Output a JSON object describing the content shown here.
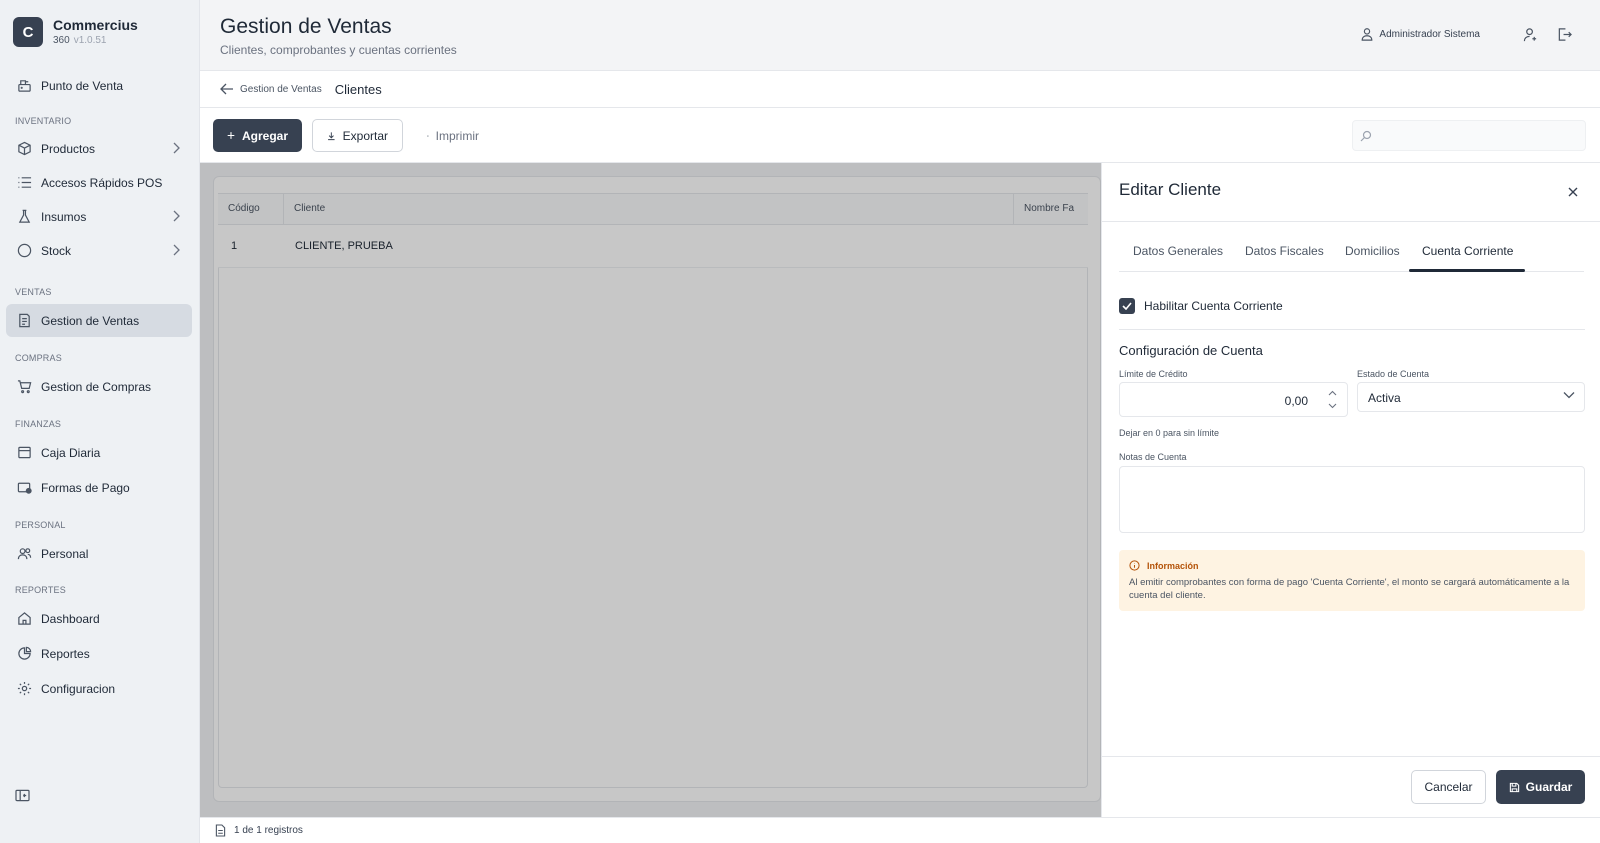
{
  "brand": {
    "logo_letter": "C",
    "name": "Commercius",
    "sub": "360",
    "version": "v1.0.51"
  },
  "sidebar": {
    "items": [
      {
        "label": "Punto de Venta",
        "icon": "cart-register-icon"
      },
      {
        "section": "INVENTARIO"
      },
      {
        "label": "Productos",
        "icon": "box-icon",
        "chevron": true
      },
      {
        "label": "Accesos Rápidos POS",
        "icon": "list-icon"
      },
      {
        "label": "Insumos",
        "icon": "flask-icon",
        "chevron": true
      },
      {
        "label": "Stock",
        "icon": "circle-icon",
        "chevron": true
      },
      {
        "section": "VENTAS"
      },
      {
        "label": "Gestion de Ventas",
        "icon": "receipt-icon",
        "active": true
      },
      {
        "section": "COMPRAS"
      },
      {
        "label": "Gestion de Compras",
        "icon": "shopping-cart-icon"
      },
      {
        "section": "FINANZAS"
      },
      {
        "label": "Caja Diaria",
        "icon": "cash-box-icon"
      },
      {
        "label": "Formas de Pago",
        "icon": "wallet-icon"
      },
      {
        "section": "PERSONAL"
      },
      {
        "label": "Personal",
        "icon": "users-icon"
      },
      {
        "section": "REPORTES"
      },
      {
        "label": "Dashboard",
        "icon": "home-icon"
      },
      {
        "label": "Reportes",
        "icon": "chart-icon"
      },
      {
        "label": "Configuracion",
        "icon": "gear-icon"
      }
    ],
    "sections": {
      "inventario": "INVENTARIO",
      "ventas": "VENTAS",
      "compras": "COMPRAS",
      "finanzas": "FINANZAS",
      "personal": "PERSONAL",
      "reportes": "REPORTES"
    },
    "labels": {
      "punto_venta": "Punto de Venta",
      "productos": "Productos",
      "accesos": "Accesos Rápidos POS",
      "insumos": "Insumos",
      "stock": "Stock",
      "gestion_ventas": "Gestion de Ventas",
      "gestion_compras": "Gestion de Compras",
      "caja": "Caja Diaria",
      "formas_pago": "Formas de Pago",
      "personal": "Personal",
      "dashboard": "Dashboard",
      "reportes": "Reportes",
      "configuracion": "Configuracion"
    }
  },
  "header": {
    "title": "Gestion de Ventas",
    "subtitle": "Clientes, comprobantes y cuentas corrientes",
    "user": "Administrador Sistema"
  },
  "breadcrumb": {
    "back": "Gestion de Ventas",
    "current": "Clientes"
  },
  "toolbar": {
    "add": "Agregar",
    "export": "Exportar",
    "print": "Imprimir"
  },
  "table": {
    "columns": [
      "Código",
      "Cliente",
      "Nombre Fa"
    ],
    "rows": [
      {
        "codigo": "1",
        "cliente": "CLIENTE, PRUEBA"
      }
    ]
  },
  "footer": {
    "records": "1 de 1 registros"
  },
  "drawer": {
    "title": "Editar Cliente",
    "tabs": [
      "Datos Generales",
      "Datos Fiscales",
      "Domicilios",
      "Cuenta Corriente"
    ],
    "active_tab": "Cuenta Corriente",
    "checkbox_label": "Habilitar Cuenta Corriente",
    "section_title": "Configuración de Cuenta",
    "limite_label": "Límite de Crédito",
    "limite_value": "0,00",
    "limite_hint": "Dejar en 0 para sin límite",
    "estado_label": "Estado de Cuenta",
    "estado_value": "Activa",
    "notas_label": "Notas de Cuenta",
    "notas_value": "",
    "info_title": "Información",
    "info_text": "Al emitir comprobantes con forma de pago 'Cuenta Corriente', el monto se cargará automáticamente a la cuenta del cliente.",
    "cancel": "Cancelar",
    "save": "Guardar"
  },
  "colors": {
    "primary": "#374151",
    "info_bg": "#fef3e2",
    "info_title": "#b45309"
  }
}
